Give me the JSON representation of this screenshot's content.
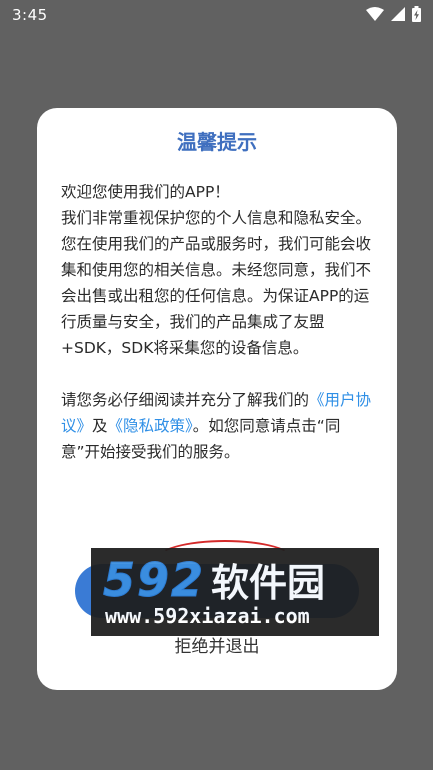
{
  "status_bar": {
    "time": "3:45",
    "icons": [
      "wifi-icon",
      "cell-signal-icon",
      "battery-charging-icon"
    ]
  },
  "dialog": {
    "title": "温馨提示",
    "intro": "欢迎您使用我们的APP！",
    "body_1": "我们非常重视保护您的个人信息和隐私安全。您在使用我们的产品或服务时，我们可能会收集和使用您的相关信息。未经您同意，我们不会出售或出租您的任何信息。为保证APP的运行质量与安全，我们的产品集成了友盟+SDK，SDK将采集您的设备信息。",
    "body_2_prefix": "请您务必仔细阅读并充分了解我们的",
    "user_agreement_link": "《用户协议》",
    "and_text": "及",
    "privacy_policy_link": "《隐私政策》",
    "body_2_suffix": "。如您同意请点击“同意”开始接受我们的服务。",
    "agree_label": "",
    "reject_label": "拒绝并退出"
  },
  "watermark": {
    "number": "592",
    "name": "软件园",
    "url": "www.592xiazai.com"
  },
  "colors": {
    "backdrop": "#616161",
    "title": "#3f6fbf",
    "link": "#2f8fe6",
    "button": "#3a7bd5",
    "watermark_number": "#3a8fe0"
  }
}
